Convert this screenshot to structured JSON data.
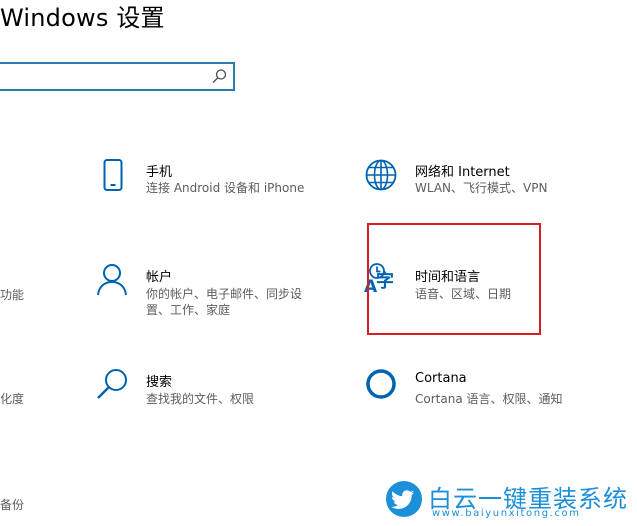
{
  "window": {
    "title": "Windows 设置"
  },
  "search": {
    "value": "",
    "placeholder": ""
  },
  "left_fragments": [
    "功能",
    "化度",
    "备份"
  ],
  "tiles": [
    {
      "id": "phone",
      "icon": "phone-icon",
      "name": "手机",
      "desc": [
        "连接 Android 设备和 iPhone"
      ]
    },
    {
      "id": "network",
      "icon": "globe-icon",
      "name": "网络和 Internet",
      "desc": [
        "WLAN、飞行模式、VPN"
      ]
    },
    {
      "id": "accounts",
      "icon": "person-icon",
      "name": "帐户",
      "desc": [
        "你的帐户、电子邮件、同步设",
        "置、工作、家庭"
      ]
    },
    {
      "id": "time-language",
      "icon": "time-language-icon",
      "name": "时间和语言",
      "desc": [
        "语音、区域、日期"
      ]
    },
    {
      "id": "search",
      "icon": "search-magnifier-icon",
      "name": "搜索",
      "desc": [
        "查找我的文件、权限"
      ]
    },
    {
      "id": "cortana",
      "icon": "cortana-ring-icon",
      "name": "Cortana",
      "desc": [
        "Cortana 语言、权限、通知"
      ]
    }
  ],
  "time_language_glyph": {
    "a": "A",
    "zi": "字"
  },
  "watermark": {
    "brand": "白云一键重装系统",
    "url": "www.baiyunxitong.com",
    "icon": "twitter-bird-icon"
  },
  "colors": {
    "accent": "#0063b1",
    "highlight": "#d81e24",
    "search_border": "#2c7cb0",
    "watermark": "#1c8fd9"
  }
}
